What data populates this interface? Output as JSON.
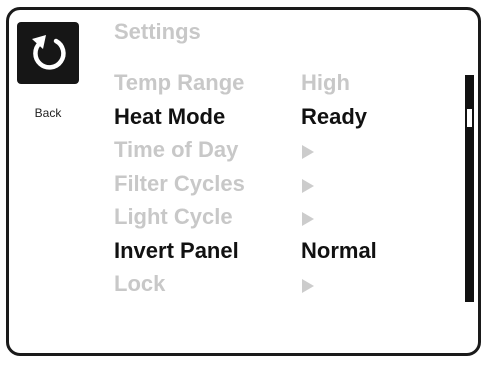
{
  "screen": {
    "title": "Settings",
    "back_label": "Back"
  },
  "menu": {
    "items": [
      {
        "label": "Temp Range",
        "value": "High",
        "state": "dim",
        "has_arrow": false
      },
      {
        "label": "Heat Mode",
        "value": "Ready",
        "state": "active",
        "has_arrow": false
      },
      {
        "label": "Time of Day",
        "value": "",
        "state": "dim",
        "has_arrow": true
      },
      {
        "label": "Filter Cycles",
        "value": "",
        "state": "dim",
        "has_arrow": true
      },
      {
        "label": "Light Cycle",
        "value": "",
        "state": "dim",
        "has_arrow": true
      },
      {
        "label": "Invert Panel",
        "value": "Normal",
        "state": "active",
        "has_arrow": false
      },
      {
        "label": "Lock",
        "value": "",
        "state": "dim",
        "has_arrow": true
      }
    ]
  },
  "icons": {
    "back": "undo-arrow-icon",
    "submenu": "play-triangle-icon"
  },
  "colors": {
    "active_text": "#111111",
    "dim_text": "#c8c8c8",
    "frame": "#1a1a1a"
  }
}
